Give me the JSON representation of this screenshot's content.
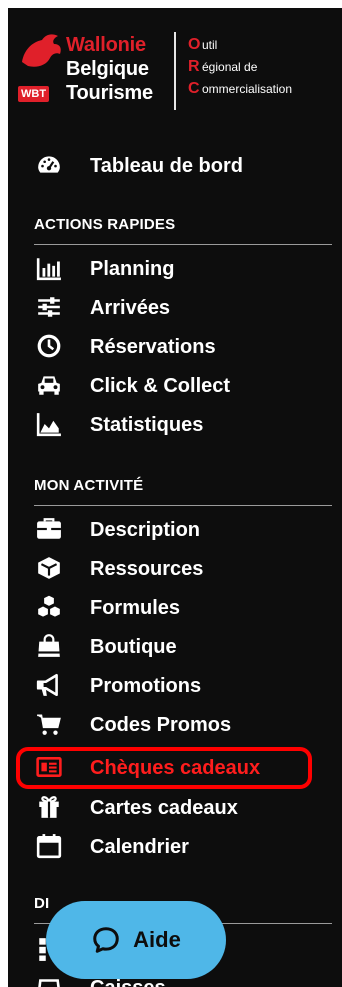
{
  "brand": {
    "line1": "Wallonie",
    "line2": "Belgique",
    "line3": "Tourisme",
    "badge": "WBT",
    "orc_lines": [
      {
        "initial": "O",
        "rest": "util"
      },
      {
        "initial": "R",
        "rest": "égional de"
      },
      {
        "initial": "C",
        "rest": "ommercialisation"
      }
    ]
  },
  "dashboard": {
    "label": "Tableau de bord",
    "icon": "dashboard-icon"
  },
  "sections": [
    {
      "title": "ACTIONS RAPIDES",
      "items": [
        {
          "label": "Planning",
          "icon": "bar-chart-icon"
        },
        {
          "label": "Arrivées",
          "icon": "sliders-icon"
        },
        {
          "label": "Réservations",
          "icon": "clock-icon"
        },
        {
          "label": "Click & Collect",
          "icon": "car-icon"
        },
        {
          "label": "Statistiques",
          "icon": "area-chart-icon"
        }
      ]
    },
    {
      "title": "MON ACTIVITÉ",
      "items": [
        {
          "label": "Description",
          "icon": "briefcase-icon"
        },
        {
          "label": "Ressources",
          "icon": "cube-icon"
        },
        {
          "label": "Formules",
          "icon": "cubes-icon"
        },
        {
          "label": "Boutique",
          "icon": "shopping-bag-icon"
        },
        {
          "label": "Promotions",
          "icon": "megaphone-icon"
        },
        {
          "label": "Codes Promos",
          "icon": "cart-icon"
        },
        {
          "label": "Chèques cadeaux",
          "icon": "gift-card-icon",
          "active": true
        },
        {
          "label": "Cartes cadeaux",
          "icon": "gift-icon"
        },
        {
          "label": "Calendrier",
          "icon": "calendar-icon"
        }
      ]
    },
    {
      "title": "DI",
      "items": [
        {
          "label": "",
          "icon": "grid-icon"
        },
        {
          "label": "Caisses",
          "icon": "register-icon"
        }
      ]
    }
  ],
  "help_button": {
    "label": "Aide",
    "icon": "chat-bubble-icon"
  },
  "colors": {
    "sidebar": "#0d0d0d",
    "accent_red": "#e0202a",
    "active_red": "#ff1d1d",
    "help_blue": "#4fb7e8"
  }
}
